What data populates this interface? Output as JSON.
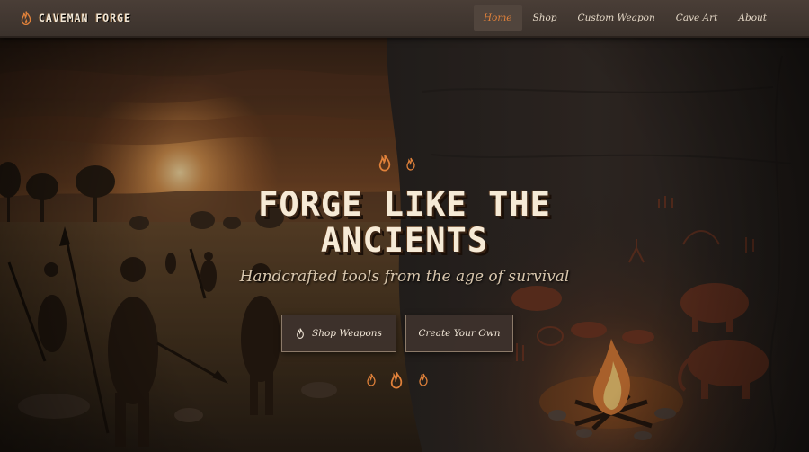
{
  "brand": {
    "name": "CAVEMAN FORGE",
    "icon": "flame-icon"
  },
  "nav": {
    "items": [
      {
        "label": "Home",
        "active": true
      },
      {
        "label": "Shop",
        "active": false
      },
      {
        "label": "Custom Weapon",
        "active": false
      },
      {
        "label": "Cave Art",
        "active": false
      },
      {
        "label": "About",
        "active": false
      }
    ]
  },
  "hero": {
    "title_line1": "FORGE LIKE THE",
    "title_line2": "ANCIENTS",
    "subtitle": "Handcrafted tools from the age of survival",
    "primary_button": {
      "label": "Shop Weapons",
      "icon": "flame-icon"
    },
    "secondary_button": {
      "label": "Create Your Own"
    }
  },
  "colors": {
    "accent": "#e0813a",
    "navbar": "#3f352f",
    "text_light": "#f1e6d6"
  }
}
